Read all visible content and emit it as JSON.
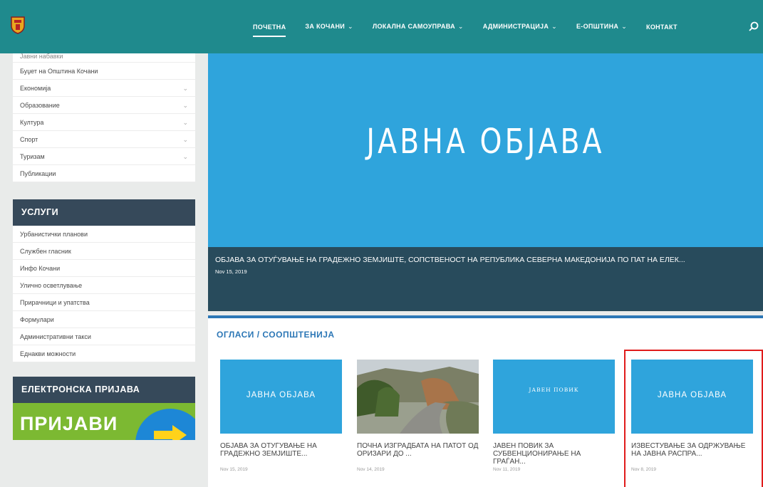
{
  "nav": {
    "items": [
      {
        "label": "ПОЧЕТНА",
        "dropdown": false,
        "active": true
      },
      {
        "label": "ЗА КОЧАНИ",
        "dropdown": true,
        "active": false
      },
      {
        "label": "ЛОКАЛНА САМОУПРАВА",
        "dropdown": true,
        "active": false
      },
      {
        "label": "АДМИНИСТРАЦИЈА",
        "dropdown": true,
        "active": false
      },
      {
        "label": "Е-ОПШТИНА",
        "dropdown": true,
        "active": false
      },
      {
        "label": "КОНТАКТ",
        "dropdown": false,
        "active": false
      }
    ],
    "chevron": "⌄",
    "search_icon": "search-icon"
  },
  "sidebar": {
    "cut_item": "Јавни набавки",
    "items": [
      {
        "label": "Буџет на Општина Кочани",
        "has_children": false
      },
      {
        "label": "Економија",
        "has_children": true
      },
      {
        "label": "Образование",
        "has_children": true
      },
      {
        "label": "Култура",
        "has_children": true
      },
      {
        "label": "Спорт",
        "has_children": true
      },
      {
        "label": "Туризам",
        "has_children": true
      },
      {
        "label": "Публикации",
        "has_children": false
      }
    ],
    "chevron": "⌄",
    "services": {
      "title": "УСЛУГИ",
      "items": [
        "Урбанистички планови",
        "Службен гласник",
        "Инфо Кочани",
        "Улично осветлување",
        "Прирачници и упатства",
        "Формулари",
        "Административни такси",
        "Еднакви можности"
      ]
    },
    "e_apply": {
      "title": "ЕЛЕКТРОНСКА ПРИЈАВА",
      "banner_text": "ПРИЈАВИ"
    }
  },
  "hero": {
    "title": "ЈАВНА ОБЈАВА",
    "caption": "ОБЈАВА ЗА ОТУЃУВАЊЕ НА ГРАДЕЖНО ЗЕМЈИШТЕ, СОПСТВЕНОСТ НА РЕПУБЛИКА СЕВЕРНА МАКЕДОНИЈА ПО ПАТ НА ЕЛЕК...",
    "date": "Nov 15, 2019"
  },
  "news": {
    "title": "ОГЛАСИ / СООПШТЕНИЈА",
    "cards": [
      {
        "thumb_text": "ЈАВНА ОБЈАВА",
        "title": "ОБЈАВА ЗА ОТУЃУВАЊЕ НА ГРАДЕЖНО ЗЕМЈИШТЕ...",
        "date": "Nov 15, 2019"
      },
      {
        "thumb_text": "",
        "title": "ПОЧНА ИЗГРАДБАТА НА ПАТОТ ОД ОРИЗАРИ ДО ...",
        "date": "Nov 14, 2019"
      },
      {
        "thumb_text": "ЈАВЕН ПОВИК",
        "title": "ЈАВЕН ПОВИК ЗА СУБВЕНЦИОНИРАЊЕ НА ГРАЃАН...",
        "date": "Nov 11, 2019"
      },
      {
        "thumb_text": "ЈАВНА ОБЈАВА",
        "title": "ИЗВЕСТУВАЊЕ ЗА ОДРЖУВАЊЕ НА ЈАВНА РАСПРА...",
        "date": "Nov 8, 2019"
      }
    ]
  },
  "colors": {
    "topbar": "#1f8a8d",
    "hero": "#2fa4dc",
    "section_head": "#36495a",
    "accent_blue": "#2c77b6",
    "highlight": "#e01b1b",
    "banner_green": "#7cb932"
  }
}
